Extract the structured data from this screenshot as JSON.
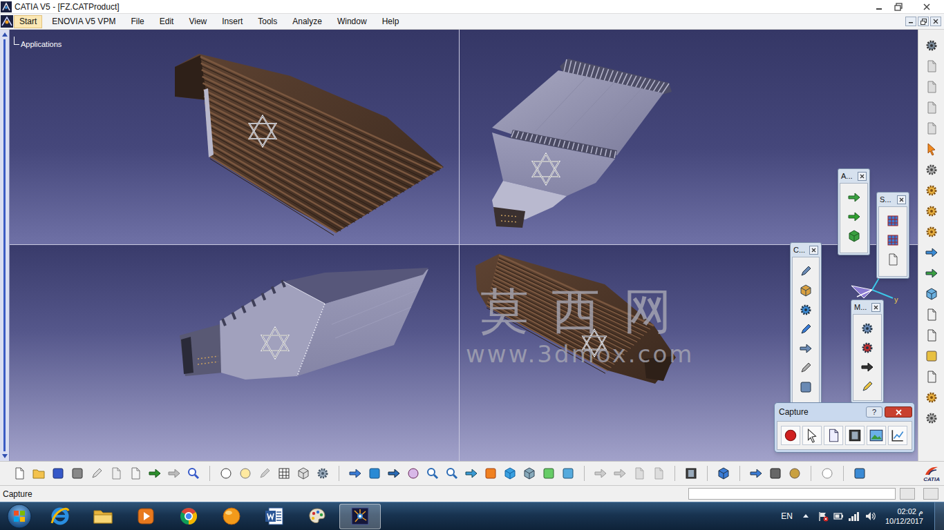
{
  "window": {
    "title": "CATIA V5 - [FZ.CATProduct]"
  },
  "menu": [
    {
      "label": "Start",
      "selected": true
    },
    {
      "label": "ENOVIA V5 VPM",
      "selected": false
    },
    {
      "label": "File",
      "selected": false
    },
    {
      "label": "Edit",
      "selected": false
    },
    {
      "label": "View",
      "selected": false
    },
    {
      "label": "Insert",
      "selected": false
    },
    {
      "label": "Tools",
      "selected": false
    },
    {
      "label": "Analyze",
      "selected": false
    },
    {
      "label": "Window",
      "selected": false
    },
    {
      "label": "Help",
      "selected": false
    }
  ],
  "tree": {
    "root": "Applications"
  },
  "watermark": {
    "title": "莫 西 网",
    "url": "www.3dmox.com"
  },
  "compass": {
    "axis": "y"
  },
  "floating_toolbars": [
    {
      "title": "A..."
    },
    {
      "title": "S..."
    },
    {
      "title": "C..."
    },
    {
      "title": "M..."
    }
  ],
  "capture_toolbar": {
    "title": "Capture",
    "help": "?"
  },
  "toolbar": {
    "brand": "CATIA"
  },
  "status_bar": {
    "text": "Capture"
  },
  "taskbar": {
    "apps": [
      {
        "kind": "ie",
        "selected": false
      },
      {
        "kind": "explorer",
        "selected": false
      },
      {
        "kind": "media",
        "selected": false
      },
      {
        "kind": "chrome",
        "selected": false
      },
      {
        "kind": "orange",
        "selected": false
      },
      {
        "kind": "word",
        "selected": false
      },
      {
        "kind": "paint",
        "selected": false
      },
      {
        "kind": "catia",
        "selected": true
      }
    ],
    "language": "EN",
    "time": "02:02 م",
    "date": "10/12/2017"
  }
}
